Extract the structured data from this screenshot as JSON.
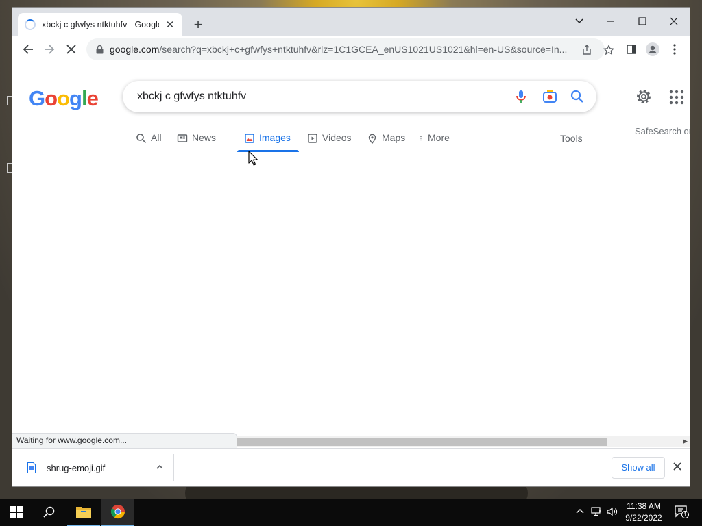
{
  "browser": {
    "tab_title": "xbckj c gfwfys ntktuhfv - Google",
    "url_main": "google.com",
    "url_rest": "/search?q=xbckj+c+gfwfys+ntktuhfv&rlz=1C1GCEA_enUS1021US1021&hl=en-US&source=In..."
  },
  "google": {
    "logo_letters": [
      "G",
      "o",
      "o",
      "g",
      "l",
      "e"
    ],
    "logo_colors": [
      "#4285f4",
      "#ea4335",
      "#fbbc05",
      "#4285f4",
      "#34a853",
      "#ea4335"
    ],
    "query": "xbckj c gfwfys ntktuhfv",
    "safesearch": "SafeSearch or",
    "tabs": [
      {
        "label": "All",
        "icon": "search-icon"
      },
      {
        "label": "News",
        "icon": "news-icon"
      },
      {
        "label": "Images",
        "icon": "image-icon",
        "active": true
      },
      {
        "label": "Videos",
        "icon": "video-icon"
      },
      {
        "label": "Maps",
        "icon": "map-pin-icon"
      },
      {
        "label": "More",
        "icon": "more-vert-icon"
      }
    ],
    "tools": "Tools"
  },
  "status_text": "Waiting for www.google.com...",
  "downloads": {
    "file_name": "shrug-emoji.gif",
    "show_all": "Show all"
  },
  "taskbar": {
    "time": "11:38 AM",
    "date": "9/22/2022",
    "notification_count": "1"
  },
  "colors": {
    "accent": "#1a73e8"
  }
}
